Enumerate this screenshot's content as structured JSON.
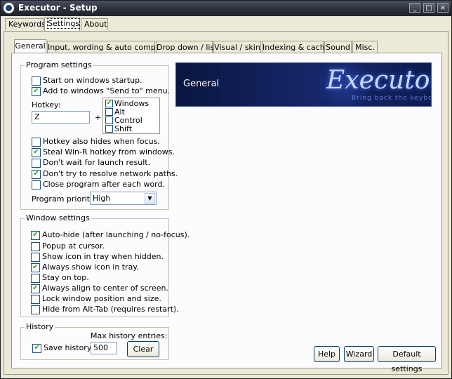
{
  "window": {
    "title": "Executor - Setup",
    "controls": [
      "_",
      "□",
      "×"
    ]
  },
  "top_tabs": [
    "Keywords",
    "Settings",
    "About"
  ],
  "settings_tabs": [
    "General",
    "Input, wording & auto completion",
    "Drop down / list",
    "Visual / skin",
    "Indexing & cache",
    "Sound",
    "Misc."
  ],
  "banner": {
    "title": "General",
    "logo": "Executor",
    "slogan": "Bring back the keyboard"
  },
  "program_settings": {
    "legend": "Program settings",
    "startup": {
      "label": "Start on windows startup.",
      "checked": false
    },
    "sendto": {
      "label": "Add to windows \"Send to\" menu.",
      "checked": true
    },
    "hotkey_label": "Hotkey:",
    "hotkey_value": "Z",
    "plus": "+",
    "modifiers": [
      {
        "label": "Windows",
        "checked": true
      },
      {
        "label": "Alt",
        "checked": false
      },
      {
        "label": "Control",
        "checked": false
      },
      {
        "label": "Shift",
        "checked": false
      }
    ],
    "options": [
      {
        "label": "Hotkey also hides when focus.",
        "checked": false
      },
      {
        "label": "Steal Win-R hotkey from windows.",
        "checked": true
      },
      {
        "label": "Don't wait for launch result.",
        "checked": false
      },
      {
        "label": "Don't try to resolve network paths.",
        "checked": true
      },
      {
        "label": "Close program after each word.",
        "checked": false
      }
    ],
    "priority_label": "Program priority:",
    "priority_value": "High"
  },
  "window_settings": {
    "legend": "Window settings",
    "options": [
      {
        "label": "Auto-hide (after launching / no-focus).",
        "checked": true
      },
      {
        "label": "Popup at cursor.",
        "checked": false
      },
      {
        "label": "Show icon in tray when hidden.",
        "checked": false
      },
      {
        "label": "Always show icon in tray.",
        "checked": true
      },
      {
        "label": "Stay on top.",
        "checked": false
      },
      {
        "label": "Always align to center of screen.",
        "checked": true
      },
      {
        "label": "Lock window position and size.",
        "checked": false
      },
      {
        "label": "Hide from Alt-Tab (requires restart).",
        "checked": false
      }
    ]
  },
  "history": {
    "legend": "History",
    "save": {
      "label": "Save history.",
      "checked": true
    },
    "max_label": "Max history entries:",
    "max_value": "500",
    "clear_label": "Clear"
  },
  "footer": {
    "help": "Help",
    "wizard": "Wizard",
    "defaults": "Default settings"
  },
  "check_mark": "✔"
}
